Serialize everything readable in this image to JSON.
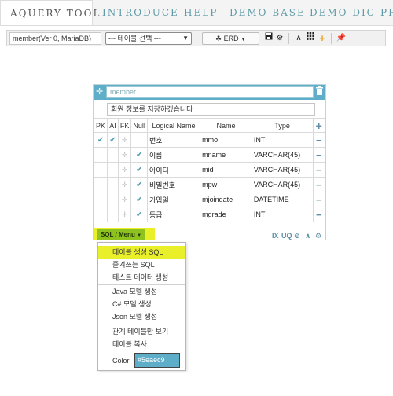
{
  "nav": {
    "tabs": [
      {
        "label": "AQUERY TOOL"
      },
      {
        "label": "INTRODUCE"
      },
      {
        "label": "HELP"
      },
      {
        "label": "DEMO BASE"
      },
      {
        "label": "DEMO DIC"
      },
      {
        "label": "PR"
      }
    ]
  },
  "toolbar": {
    "db_label": "member(Ver 0, MariaDB)",
    "table_select": "--- 테이블 선택 ---",
    "erd_label": "ERD",
    "icons": [
      "save-icon",
      "gear-icon",
      "chevron-up-icon",
      "grid-icon",
      "plus-icon",
      "pin-icon"
    ]
  },
  "table": {
    "name": "member",
    "comment": "회원 정보를 저장하겠습니다",
    "headers": {
      "pk": "PK",
      "ai": "AI",
      "fk": "FK",
      "null": "Null",
      "logical": "Logical Name",
      "name": "Name",
      "type": "Type"
    },
    "columns": [
      {
        "pk": true,
        "ai": true,
        "fk": false,
        "nullable": false,
        "logical": "번호",
        "name": "mmo",
        "type": "INT"
      },
      {
        "pk": false,
        "ai": false,
        "fk": false,
        "nullable": true,
        "logical": "이름",
        "name": "mname",
        "type": "VARCHAR(45)"
      },
      {
        "pk": false,
        "ai": false,
        "fk": false,
        "nullable": true,
        "logical": "아이디",
        "name": "mid",
        "type": "VARCHAR(45)"
      },
      {
        "pk": false,
        "ai": false,
        "fk": false,
        "nullable": true,
        "logical": "비밀번호",
        "name": "mpw",
        "type": "VARCHAR(45)"
      },
      {
        "pk": false,
        "ai": false,
        "fk": false,
        "nullable": true,
        "logical": "가입일",
        "name": "mjoindate",
        "type": "DATETIME"
      },
      {
        "pk": false,
        "ai": false,
        "fk": false,
        "nullable": true,
        "logical": "등급",
        "name": "mgrade",
        "type": "INT"
      }
    ],
    "footer": {
      "menu_button": "SQL / Menu",
      "ix": "IX",
      "uq": "UQ"
    }
  },
  "menu": {
    "items": [
      {
        "label": "테이블 생성 SQL",
        "highlighted": true
      },
      {
        "label": "즐겨쓰는 SQL"
      },
      {
        "label": "테스트 데이터 생성"
      },
      {
        "label": "Java 모델 생성"
      },
      {
        "label": "C# 모델 생성"
      },
      {
        "label": "Json 모델 생성"
      },
      {
        "label": "관계 테이블만 보기"
      },
      {
        "label": "테이블 복사"
      }
    ],
    "color_label": "Color",
    "color_value": "#5eaec9"
  },
  "colors": {
    "header": "#5eaec9",
    "accent": "#4f9ab3",
    "highlight": "#e9f02a",
    "menu_button": "#8dc21f"
  }
}
